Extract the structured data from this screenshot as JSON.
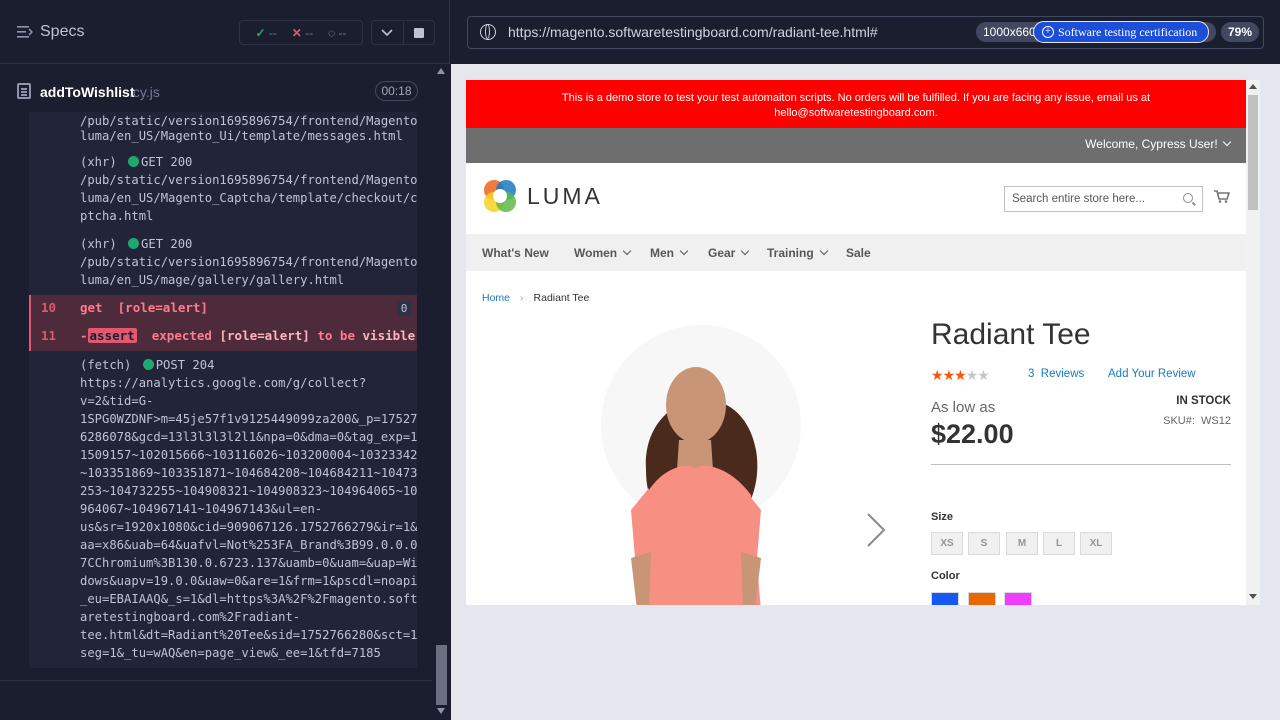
{
  "reporter": {
    "title": "Specs",
    "stats": {
      "passed": "--",
      "failed": "--",
      "pending": "--"
    },
    "spec": {
      "name": "addToWishlist",
      "ext": ".cy.js",
      "time": "00:18"
    }
  },
  "log": {
    "l0": "/pub/static/version1695896754/frontend/Magento/",
    "l1": "luma/en_US/Magento_Ui/template/messages.html",
    "x1_kind": "(xhr)",
    "x1_method": "GET 200",
    "x1_a": "/pub/static/version1695896754/frontend/Magento/",
    "x1_b": "luma/en_US/Magento_Captcha/template/checkout/ca",
    "x1_c": "ptcha.html",
    "x2_kind": "(xhr)",
    "x2_method": "GET 200",
    "x2_a": "/pub/static/version1695896754/frontend/Magento/",
    "x2_b": "luma/en_US/mage/gallery/gallery.html",
    "c10_num": "10",
    "c10_cmd": "get",
    "c10_sel": "[role=alert]",
    "c10_count": "0",
    "c11_num": "11",
    "c11_dash": "-",
    "c11_cmd": "assert",
    "c11_a": "expected",
    "c11_sel": "[role=alert]",
    "c11_b": "to be",
    "c11_c": "visible",
    "f_kind": "(fetch)",
    "f_method": "POST 204",
    "f_lines": [
      "https://analytics.google.com/g/collect?",
      "v=2&tid=G-",
      "1SPG0WZDNF>m=45je57f1v9125449099za200&_p=175276",
      "6286078&gcd=13l3l3l3l2l1&npa=0&dma=0&tag_exp=10",
      "1509157~102015666~103116026~103200004~103233427",
      "~103351869~103351871~104684208~104684211~104732",
      "253~104732255~104908321~104908323~104964065~104",
      "964067~104967141~104967143&ul=en-",
      "us&sr=1920x1080&cid=909067126.1752766279&ir=1&u",
      "aa=x86&uab=64&uafvl=Not%253FA_Brand%3B99.0.0.0%",
      "7CChromium%3B130.0.6723.137&uamb=0&uam=&uap=Win",
      "dows&uapv=19.0.0&uaw=0&are=1&frm=1&pscdl=noapi&",
      "_eu=EBAIAAQ&_s=1&dl=https%3A%2F%2Fmagento.softw",
      "aretestingboard.com%2Fradiant-",
      "tee.html&dt=Radiant%20Tee&sid=1752766280&sct=1&",
      "seg=1&_tu=wAQ&en=page_view&_ee=1&tfd=7185"
    ]
  },
  "aut": {
    "url": "https://magento.softwaretestingboard.com/radiant-tee.html#",
    "viewport": "1000x660",
    "cert_label": "Software testing certification",
    "zoom": "79%"
  },
  "site": {
    "banner_line1": "This is a demo store to test your test automaiton scripts. No orders will be fulfilled. If you are facing any issue, email us at",
    "banner_line2": "hello@softwaretestingboard.com.",
    "welcome": "Welcome, Cypress User!",
    "logo_text": "LUMA",
    "search_placeholder": "Search entire store here...",
    "nav": [
      "What's New",
      "Women",
      "Men",
      "Gear",
      "Training",
      "Sale"
    ],
    "breadcrumb_home": "Home",
    "breadcrumb_current": "Radiant Tee",
    "product_title": "Radiant Tee",
    "rating": 3,
    "reviews_count": "3",
    "reviews_label": "Reviews",
    "add_review": "Add Your Review",
    "as_low_as": "As low as",
    "price": "$22.00",
    "stock": "IN STOCK",
    "sku_label": "SKU#:",
    "sku": "WS12",
    "size_label": "Size",
    "sizes": [
      "XS",
      "S",
      "M",
      "L",
      "XL"
    ],
    "color_label": "Color",
    "colors": [
      "#1857f7",
      "#eb6703",
      "#ef3dff"
    ]
  }
}
